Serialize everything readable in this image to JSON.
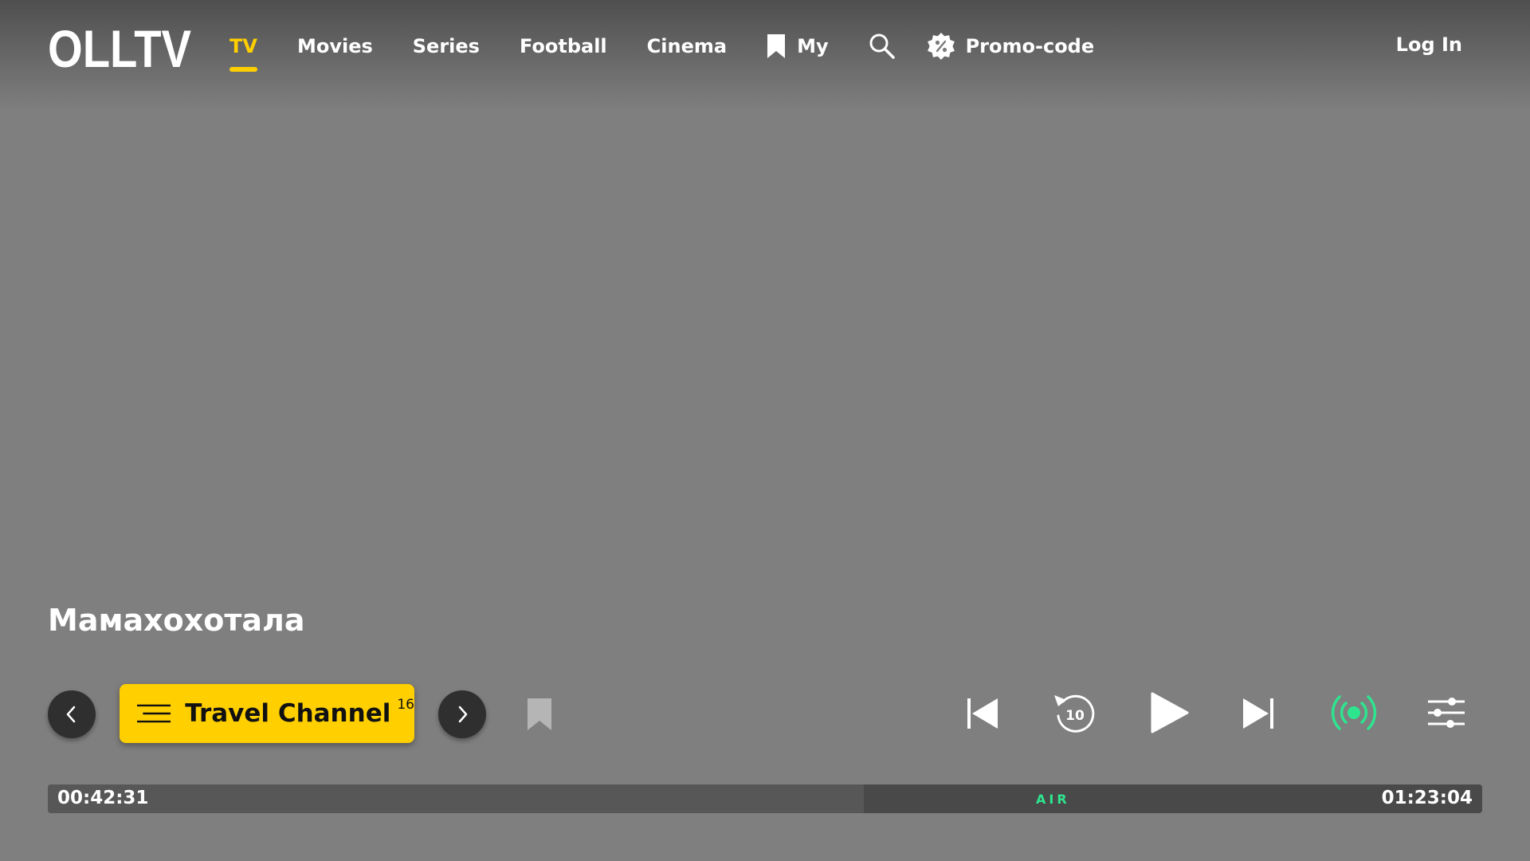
{
  "header": {
    "logo_text": "OLLTV",
    "nav": [
      {
        "label": "TV",
        "active": true
      },
      {
        "label": "Movies"
      },
      {
        "label": "Series"
      },
      {
        "label": "Football"
      },
      {
        "label": "Cinema"
      },
      {
        "label": "My",
        "icon": "bookmark-icon"
      }
    ],
    "search_icon": "search-icon",
    "promo": {
      "label": "Promo-code",
      "icon": "percent-badge-icon"
    },
    "login_label": "Log In"
  },
  "program": {
    "title": "Мамахохотала"
  },
  "channel": {
    "name": "Travel Channel",
    "age_rating": "16"
  },
  "controls": {
    "rewind_seconds": "10",
    "icons": [
      "chevron-left-icon",
      "chevron-right-icon",
      "bookmark-icon",
      "skip-previous-icon",
      "rewind-10-icon",
      "play-icon",
      "skip-next-icon",
      "live-broadcast-icon",
      "settings-sliders-icon"
    ]
  },
  "progress": {
    "elapsed": "00:42:31",
    "total": "01:23:04",
    "air_label": "AIR",
    "fraction": 0.569
  },
  "colors": {
    "accent": "#ffcf00",
    "live": "#2ee58f",
    "background": "#7f7f7f"
  }
}
